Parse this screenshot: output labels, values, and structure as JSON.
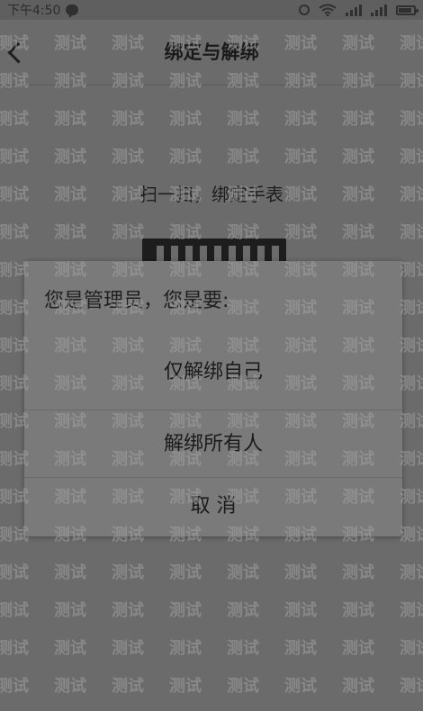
{
  "status_bar": {
    "time": "下午4:50"
  },
  "header": {
    "title": "绑定与解绑"
  },
  "content": {
    "scan_hint": "扫一扫，绑定手表"
  },
  "dialog": {
    "title": "您是管理员，您是要:",
    "option_unbind_self": "仅解绑自己",
    "option_unbind_all": "解绑所有人",
    "cancel": "取 消"
  },
  "watermark": {
    "text": "测试"
  },
  "icons": {
    "back": "chevron-left-icon",
    "chat": "chat-bubble-icon",
    "alarm": "alarm-icon",
    "wifi": "wifi-icon",
    "signal": "signal-icon",
    "battery": "battery-icon"
  },
  "battery_level": 0.85
}
